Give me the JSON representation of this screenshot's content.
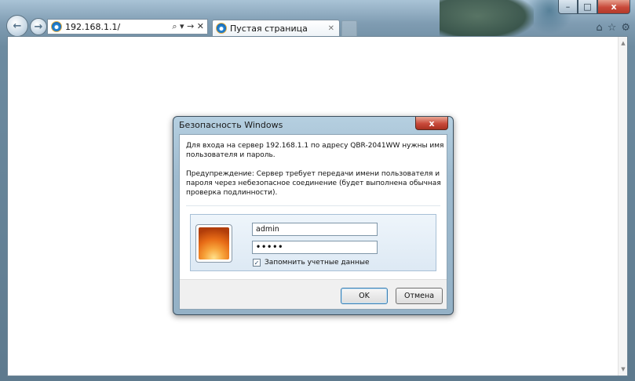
{
  "browser": {
    "address": "192.168.1.1/",
    "address_tools": "⌕ ▾ → ✕",
    "tab_title": "Пустая страница",
    "tab_close": "✕",
    "window_controls": {
      "minimize": "–",
      "maximize": "□",
      "close": "x"
    },
    "toolbar_icons": [
      "home-icon",
      "favorites-icon",
      "settings-icon"
    ],
    "toolbar_glyphs": {
      "home": "⌂",
      "favorites": "☆",
      "settings": "⚙"
    }
  },
  "dialog": {
    "title": "Безопасность Windows",
    "close": "x",
    "message": "Для входа на сервер 192.168.1.1 по адресу QBR-2041WW нужны имя пользователя и пароль.",
    "warning": "Предупреждение: Сервер требует передачи имени пользователя и пароля через небезопасное соединение (будет выполнена обычная проверка подлинности).",
    "username": "admin",
    "password_mask": "•••••",
    "remember_checked": true,
    "remember_mark": "✓",
    "remember_label": "Запомнить учетные данные",
    "ok_label": "OK",
    "cancel_label": "Отмена"
  }
}
